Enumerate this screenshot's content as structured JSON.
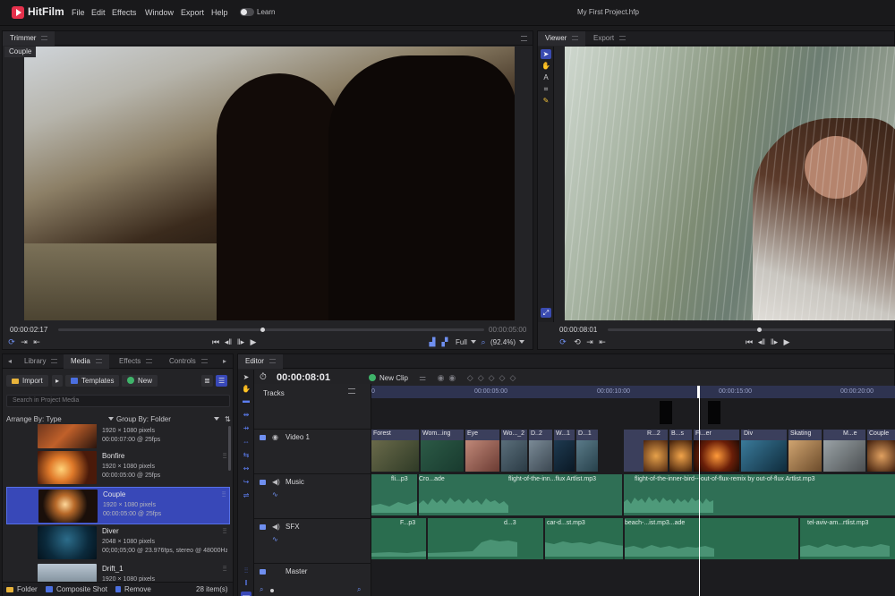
{
  "app": {
    "name": "HitFilm",
    "menu": [
      "File",
      "Edit",
      "Effects",
      "Window",
      "Export",
      "Help"
    ],
    "learn_label": "Learn",
    "project_title": "My First Project.hfp"
  },
  "trimmer": {
    "tab": "Trimmer",
    "clip_label": "Couple",
    "time_current": "00:00:02:17",
    "time_end": "00:00:05:00",
    "playback_position": 0.48,
    "quality": "Full",
    "zoom": "(92.4%)"
  },
  "viewer": {
    "tabs": [
      "Viewer",
      "Export"
    ],
    "time_current": "00:00:08:01",
    "playback_position": 0.53
  },
  "media_panel": {
    "tabs": [
      "Library",
      "Media",
      "Effects",
      "Controls"
    ],
    "import_label": "Import",
    "templates_label": "Templates",
    "new_label": "New",
    "search_placeholder": "Search in Project Media",
    "arrange_label": "Arrange By: Type",
    "group_label": "Group By: Folder",
    "items": [
      {
        "name": "",
        "meta1": "1920 × 1080 pixels",
        "meta2": "00:00:07:00 @ 25fps",
        "selected": false
      },
      {
        "name": "Bonfire",
        "meta1": "1920 × 1080 pixels",
        "meta2": "00:00:05:00 @ 25fps",
        "selected": false
      },
      {
        "name": "Couple",
        "meta1": "1920 × 1080 pixels",
        "meta2": "00:00:05:00 @ 25fps",
        "selected": true
      },
      {
        "name": "Diver",
        "meta1": "2048 × 1080 pixels",
        "meta2": "00;00;05;00 @ 23.976fps, stereo @ 48000Hz",
        "selected": false
      },
      {
        "name": "Drift_1",
        "meta1": "1920 × 1080 pixels",
        "meta2": "",
        "selected": false
      }
    ],
    "footer": {
      "folder": "Folder",
      "composite": "Composite Shot",
      "remove": "Remove",
      "count": "28 item(s)"
    }
  },
  "editor": {
    "tab": "Editor",
    "time_current": "00:00:08:01",
    "new_clip_label": "New Clip",
    "tracks_label": "Tracks",
    "ruler_ticks": [
      "0",
      "00:00:05:00",
      "00:00:10:00",
      "00:00:15:00",
      "00:00:20:00"
    ],
    "tracks": [
      "Video 1",
      "Music",
      "SFX",
      "Master"
    ],
    "video_clips": [
      "Forest",
      "Wom...ing",
      "Eye",
      "Wo..._2",
      "D..2",
      "W...1",
      "D...1",
      "R...2",
      "B...s",
      "Fi...er",
      "Div",
      "Skating",
      "M...e",
      "Couple"
    ],
    "music_clips": [
      "fli...p3",
      "Cro...ade",
      "flight-of-the-inn...flux Artlist.mp3",
      "flight-of-the-inner-bird---out-of-flux-remix by out-of-flux Artlist.mp3"
    ],
    "sfx_clips": [
      "F...p3",
      "d...3",
      "car-d...st.mp3",
      "beach-...ist.mp3...ade",
      "tel-aviv-am...rtlist.mp3"
    ]
  },
  "colors": {
    "accent": "#3848b8",
    "brand": "#e5314c",
    "audio_track": "#2f6f55",
    "video_track": "#3b3f5c"
  }
}
